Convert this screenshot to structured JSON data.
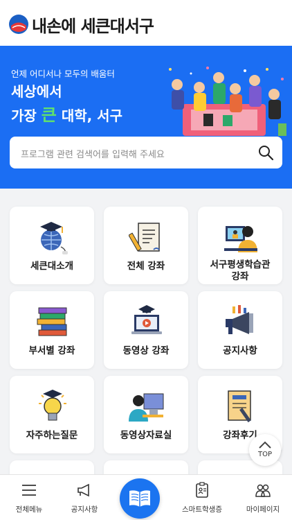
{
  "header": {
    "logo_text": "내손에 세큰대서구",
    "logo_icon": "seo-gu-logo-icon"
  },
  "hero": {
    "subtitle": "언제 어디서나 모두의 배움터",
    "line1": "세상에서",
    "line2_prefix": "가장 ",
    "line2_highlight": "큰",
    "line2_suffix": " 대학, 서구",
    "highlight_color": "#5fe06f",
    "background_color": "#1b6ef3"
  },
  "search": {
    "placeholder": "프로그램 관련 검색어를 입력해 주세요",
    "icon": "search-icon"
  },
  "menu": [
    {
      "label": "세큰대소개",
      "icon": "graduation-globe-icon"
    },
    {
      "label": "전체 강좌",
      "icon": "document-pencil-icon"
    },
    {
      "label_line1": "서구평생학습관",
      "label_line2": "강좌",
      "icon": "online-lecture-icon"
    },
    {
      "label": "부서별 강좌",
      "icon": "books-stack-icon"
    },
    {
      "label": "동영상 강좌",
      "icon": "video-laptop-icon"
    },
    {
      "label": "공지사항",
      "icon": "megaphone-icon"
    },
    {
      "label": "자주하는질문",
      "icon": "lightbulb-icon"
    },
    {
      "label": "동영상자료실",
      "icon": "person-computer-icon"
    },
    {
      "label": "강좌후기",
      "icon": "notebook-pen-icon"
    }
  ],
  "top_button": {
    "label": "TOP"
  },
  "bottom_nav": [
    {
      "label": "전체메뉴",
      "icon": "hamburger-menu-icon"
    },
    {
      "label": "공지사항",
      "icon": "megaphone-outline-icon"
    },
    {
      "label": "",
      "icon": "open-book-icon"
    },
    {
      "label": "스마트학생증",
      "icon": "id-card-icon"
    },
    {
      "label": "마이페이지",
      "icon": "users-icon"
    }
  ]
}
